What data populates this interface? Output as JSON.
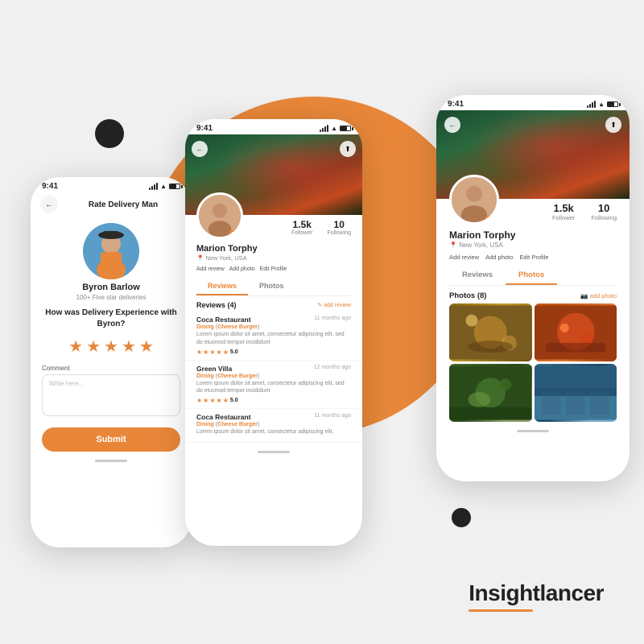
{
  "background": {
    "accent_color": "#E8873A"
  },
  "branding": {
    "name": "Insightlancer"
  },
  "phone1": {
    "status_bar": {
      "time": "9:41"
    },
    "header": {
      "back_label": "←",
      "title": "Rate Delivery  Man"
    },
    "deliveryman": {
      "name": "Byron Barlow",
      "stats": "100+ Five star deliveries"
    },
    "question": "How was Delivery Experience with Byron?",
    "stars_count": 5,
    "comment": {
      "label": "Comment",
      "placeholder": "Write here.."
    },
    "submit_label": "Submit"
  },
  "phone2": {
    "status_bar": {
      "time": "9:41"
    },
    "profile": {
      "follower_count": "1.5k",
      "follower_label": "Follower",
      "following_count": "10",
      "following_label": "Following",
      "name": "Marion Torphy",
      "location": "New York, USA",
      "edit_label": "Edit"
    },
    "actions": {
      "add_review": "Add review",
      "add_photo": "Add photo",
      "edit_profile": "Edit Profile"
    },
    "tabs": {
      "reviews_label": "Reviews",
      "photos_label": "Photos",
      "active": "reviews"
    },
    "reviews": {
      "title": "Reviews (4)",
      "add_btn": "add review",
      "items": [
        {
          "restaurant": "Coca Restaurant",
          "time": "11 months ago",
          "dining_type": "Dining",
          "tag": "Cheese Burger",
          "text": "Lorem ipsum dolor sit amet, consectetur adipiscing elit, sed do eiusmod tempor incididunt",
          "rating": "5.0"
        },
        {
          "restaurant": "Green Villa",
          "time": "12 months ago",
          "dining_type": "Dining",
          "tag": "Cheese Burger",
          "text": "Lorem ipsum dolor sit amet, consectetur adipiscing elit, sed do eiusmod tempor incididunt",
          "rating": "5.0"
        },
        {
          "restaurant": "Coca Restaurant",
          "time": "11 months ago",
          "dining_type": "Dining",
          "tag": "Cheese Burger",
          "text": "Lorem ipsum dolor sit amet, consectetur adipiscing elit,",
          "rating": ""
        }
      ]
    }
  },
  "phone3": {
    "status_bar": {
      "time": "9:41"
    },
    "profile": {
      "follower_count": "1.5k",
      "follower_label": "Follower",
      "following_count": "10",
      "following_label": "Following",
      "name": "Marion Torphy",
      "location": "New York, USA",
      "edit_label": "Edit"
    },
    "actions": {
      "add_review": "Add review",
      "add_photo": "Add photo",
      "edit_profile": "Edit Profile"
    },
    "tabs": {
      "reviews_label": "Reviews",
      "photos_label": "Photos",
      "active": "photos"
    },
    "photos": {
      "title": "Photos (8)",
      "add_btn": "add photo"
    }
  }
}
